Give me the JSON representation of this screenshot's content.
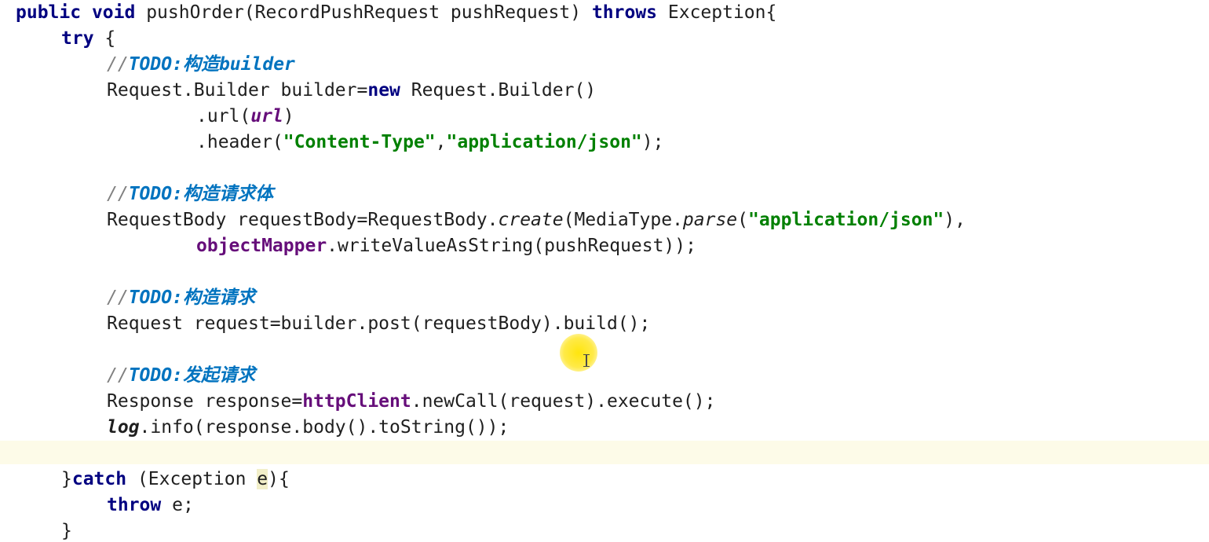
{
  "editor": {
    "lines": [
      {
        "tokens": [
          {
            "t": "public",
            "c": "kw"
          },
          {
            "t": " ",
            "c": "plain"
          },
          {
            "t": "void",
            "c": "kw"
          },
          {
            "t": " pushOrder(RecordPushRequest pushRequest) ",
            "c": "plain"
          },
          {
            "t": "throws",
            "c": "kw"
          },
          {
            "t": " Exception{",
            "c": "plain"
          }
        ]
      },
      {
        "tokens": [
          {
            "t": "try",
            "c": "kw"
          },
          {
            "t": " {",
            "c": "plain"
          }
        ]
      },
      {
        "tokens": [
          {
            "t": "//",
            "c": "cm"
          },
          {
            "t": "TODO:",
            "c": "todo"
          },
          {
            "t": "构造",
            "c": "cjk"
          },
          {
            "t": "builder",
            "c": "todo"
          }
        ]
      },
      {
        "tokens": [
          {
            "t": "Request.Builder builder=",
            "c": "plain"
          },
          {
            "t": "new",
            "c": "kw"
          },
          {
            "t": " Request.Builder()",
            "c": "plain"
          }
        ]
      },
      {
        "tokens": [
          {
            "t": ".url(",
            "c": "plain"
          },
          {
            "t": "url",
            "c": "italfield"
          },
          {
            "t": ")",
            "c": "plain"
          }
        ]
      },
      {
        "tokens": [
          {
            "t": ".header(",
            "c": "plain"
          },
          {
            "t": "\"Content-Type\"",
            "c": "str"
          },
          {
            "t": ",",
            "c": "plain"
          },
          {
            "t": "\"application/json\"",
            "c": "str"
          },
          {
            "t": ");",
            "c": "plain"
          }
        ]
      },
      {
        "tokens": []
      },
      {
        "tokens": [
          {
            "t": "//",
            "c": "cm"
          },
          {
            "t": "TODO:",
            "c": "todo"
          },
          {
            "t": "构造请求体",
            "c": "cjk"
          }
        ]
      },
      {
        "tokens": [
          {
            "t": "RequestBody requestBody=RequestBody.",
            "c": "plain"
          },
          {
            "t": "create",
            "c": "ital"
          },
          {
            "t": "(MediaType.",
            "c": "plain"
          },
          {
            "t": "parse",
            "c": "ital"
          },
          {
            "t": "(",
            "c": "plain"
          },
          {
            "t": "\"application/json\"",
            "c": "str"
          },
          {
            "t": "),",
            "c": "plain"
          }
        ]
      },
      {
        "tokens": [
          {
            "t": "objectMapper",
            "c": "field"
          },
          {
            "t": ".writeValueAsString(pushRequest));",
            "c": "plain"
          }
        ]
      },
      {
        "tokens": []
      },
      {
        "tokens": [
          {
            "t": "//",
            "c": "cm"
          },
          {
            "t": "TODO:",
            "c": "todo"
          },
          {
            "t": "构造请求",
            "c": "cjk"
          }
        ]
      },
      {
        "tokens": [
          {
            "t": "Request request=builder.post(requestBody).build();",
            "c": "plain"
          }
        ]
      },
      {
        "tokens": []
      },
      {
        "tokens": [
          {
            "t": "//",
            "c": "cm"
          },
          {
            "t": "TODO:",
            "c": "todo"
          },
          {
            "t": "发起请求",
            "c": "cjk"
          }
        ]
      },
      {
        "tokens": [
          {
            "t": "Response response=",
            "c": "plain"
          },
          {
            "t": "httpClient",
            "c": "field"
          },
          {
            "t": ".newCall(request).execute();",
            "c": "plain"
          }
        ]
      },
      {
        "tokens": [
          {
            "t": "log",
            "c": "staticf"
          },
          {
            "t": ".info(response.body().toString());",
            "c": "plain"
          }
        ]
      },
      {
        "tokens": []
      },
      {
        "tokens": [
          {
            "t": "}",
            "c": "plain"
          },
          {
            "t": "catch",
            "c": "kw"
          },
          {
            "t": " (Exception ",
            "c": "plain"
          },
          {
            "t": "e",
            "c": "param-hl"
          },
          {
            "t": "){",
            "c": "plain"
          }
        ]
      },
      {
        "tokens": [
          {
            "t": "throw",
            "c": "kw"
          },
          {
            "t": " e;",
            "c": "plain"
          }
        ]
      },
      {
        "tokens": [
          {
            "t": "}",
            "c": "plain"
          }
        ]
      }
    ]
  }
}
